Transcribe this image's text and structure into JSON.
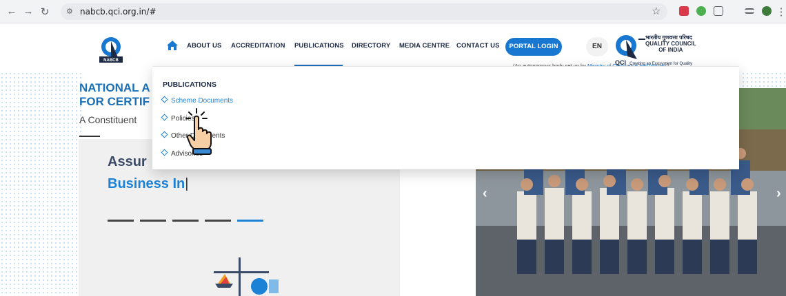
{
  "browser": {
    "url": "nabcb.qci.org.in/#",
    "back_icon": "arrow-left",
    "forward_icon": "arrow-right",
    "reload_icon": "reload",
    "site_info_icon": "tune",
    "bookmark_icon": "star"
  },
  "header": {
    "logo_label": "NABCB",
    "nav_items": [
      "ABOUT US",
      "ACCREDITATION",
      "PUBLICATIONS",
      "DIRECTORY",
      "MEDIA CENTRE",
      "CONTACT US"
    ],
    "active_nav": "PUBLICATIONS",
    "portal_login": "PORTAL LOGIN",
    "language": "EN",
    "qci_hindi": "भारतीय गुणवत्ता परिषद",
    "qci_line1": "QUALITY COUNCIL",
    "qci_line2": "OF INDIA",
    "qci_tagline": "Creating an Ecosystem for Quality",
    "qci_abbr": "QCI",
    "autonomous_prefix": "(An autonomous body set up by ",
    "autonomous_link": "Ministry of Commerce and Industry",
    "autonomous_suffix": ")"
  },
  "dropdown": {
    "title": "PUBLICATIONS",
    "items": [
      "Scheme Documents",
      "Policies",
      "Other Documents",
      "Advisories"
    ],
    "active_item": "Scheme Documents"
  },
  "hero": {
    "title_line1": "NATIONAL A",
    "title_line2": "FOR CERTIF",
    "subtitle": "A Constituent",
    "headline1": "Assur",
    "headline2": "Business In"
  },
  "colors": {
    "brand_blue": "#1777d1",
    "navy": "#1d2a44"
  }
}
